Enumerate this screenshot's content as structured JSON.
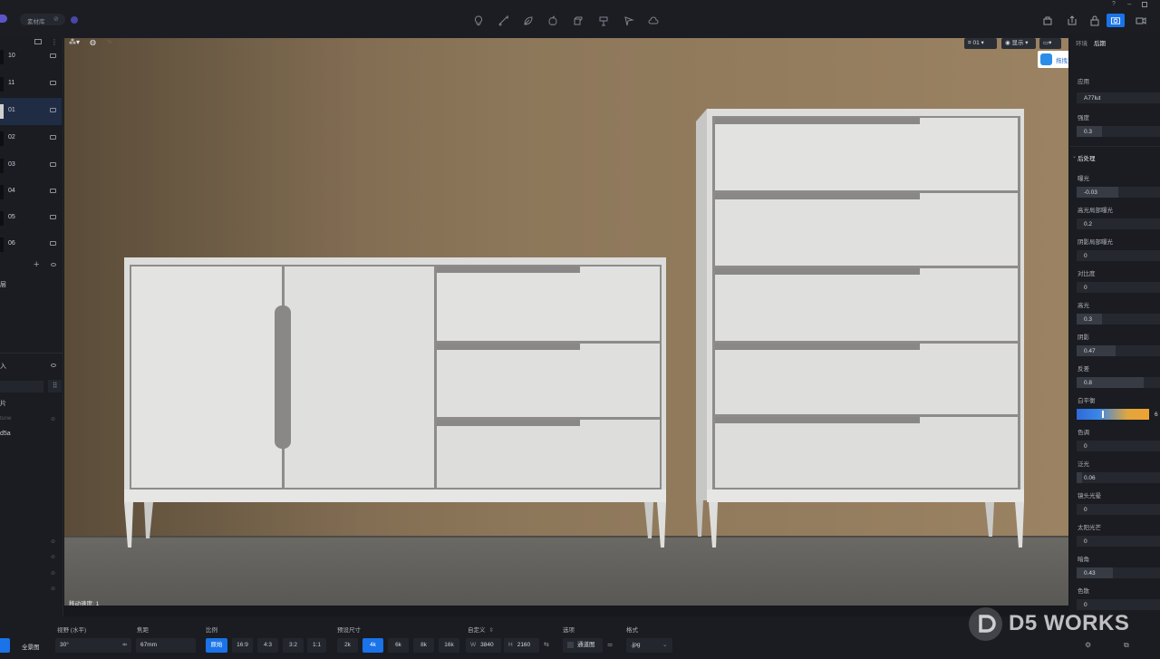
{
  "topbar": {
    "library_button": "素材库",
    "tools": [
      "light-bulb-icon",
      "path-icon",
      "leaf-icon",
      "apple-icon",
      "cube-icon",
      "brush-icon",
      "fan-icon",
      "cloud-icon"
    ],
    "right_tools": [
      "render-icon",
      "export-icon",
      "lock-icon",
      "camera-icon",
      "video-icon"
    ]
  },
  "left_panel": {
    "cameras": [
      {
        "label": "10",
        "selected": false
      },
      {
        "label": "11",
        "selected": false
      },
      {
        "label": "01",
        "selected": true
      },
      {
        "label": "02",
        "selected": false
      },
      {
        "label": "03",
        "selected": false
      },
      {
        "label": "04",
        "selected": false
      },
      {
        "label": "05",
        "selected": false
      },
      {
        "label": "06",
        "selected": false
      }
    ],
    "layer_text": "层",
    "section_text": "入",
    "list_items": [
      "片",
      "tune",
      "d5a"
    ]
  },
  "viewport": {
    "camera_select": "01",
    "display_button": "显示",
    "upload_button": "拖拽至此上传",
    "speed_text": "移动速度: 1"
  },
  "right_panel": {
    "tabs": [
      "环境",
      "后期"
    ],
    "apply_label": "应用",
    "lut_value": "A77lut",
    "intensity_label": "强度",
    "intensity_value": "0.3",
    "section_title": "后处理",
    "params": [
      {
        "label": "曝光",
        "value": "-0.03",
        "fill": 0.5
      },
      {
        "label": "高光局部曝光",
        "value": "0.2",
        "fill": 0.0
      },
      {
        "label": "阴影局部曝光",
        "value": "0",
        "fill": 0.0
      },
      {
        "label": "对比度",
        "value": "0",
        "fill": 0.0
      },
      {
        "label": "高光",
        "value": "0.3",
        "fill": 0.3
      },
      {
        "label": "阴影",
        "value": "0.47",
        "fill": 0.47
      },
      {
        "label": "反差",
        "value": "0.8",
        "fill": 0.8
      },
      {
        "label": "白平衡",
        "value": "6",
        "fill": 0.35
      },
      {
        "label": "色调",
        "value": "0",
        "fill": 0.0
      },
      {
        "label": "泛光",
        "value": "0.06",
        "fill": 0.06
      },
      {
        "label": "镜头光晕",
        "value": "0",
        "fill": 0.0
      },
      {
        "label": "太阳光芒",
        "value": "0",
        "fill": 0.0
      },
      {
        "label": "暗角",
        "value": "0.43",
        "fill": 0.43
      },
      {
        "label": "色散",
        "value": "0",
        "fill": 0.0
      }
    ]
  },
  "bottom_bar": {
    "panorama_button": "全景图",
    "fov_label": "视野 (水平)",
    "fov_value": "30°",
    "focal_label": "焦距",
    "focal_value": "67mm",
    "ratio_label": "比例",
    "ratios": [
      "原始",
      "16:9",
      "4:3",
      "3:2",
      "1:1"
    ],
    "ratio_selected": "原始",
    "preset_label": "预设尺寸",
    "presets": [
      "2k",
      "4k",
      "6k",
      "8k",
      "16k"
    ],
    "preset_selected": "4k",
    "custom_label": "自定义",
    "width_prefix": "W",
    "width_value": "3840",
    "height_prefix": "H",
    "height_value": "2160",
    "options_label": "选项",
    "channel_label": "通道图",
    "format_label": "格式",
    "format_value": ".jpg"
  },
  "watermark": "D5 WORKS",
  "colors": {
    "accent": "#1a73e8",
    "wall": "#8a7458",
    "floor": "#5e5c58",
    "cabinet": "#dcdcda"
  }
}
